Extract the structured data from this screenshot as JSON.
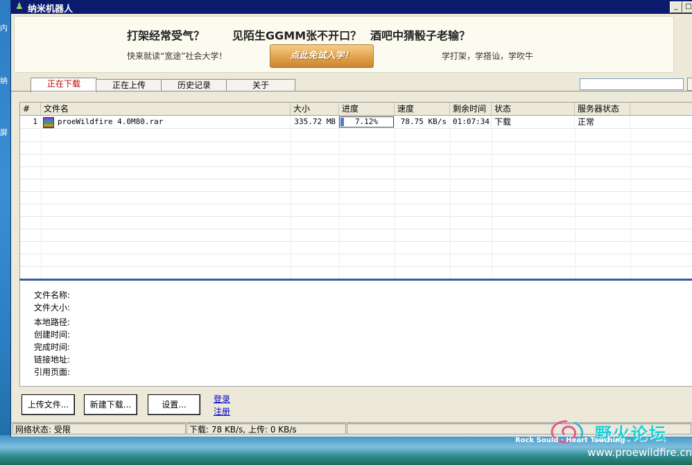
{
  "desktop": {
    "left_labels": [
      "内",
      "纳",
      "屏"
    ]
  },
  "window": {
    "title": "纳米机器人",
    "min_label": "_",
    "max_label": "□"
  },
  "banner": {
    "ad1": "打架经常受气？",
    "ad2": "见陌生GGMM张不开口？",
    "ad3": "酒吧中猜骰子老输？",
    "sub1": "快来就读“宽途”社会大学！",
    "button": "点此免试入学！",
    "sub2": "学打架，学搭讪，学吹牛"
  },
  "tabs": [
    {
      "label": "正在下载",
      "active": true
    },
    {
      "label": "正在上传",
      "active": false
    },
    {
      "label": "历史记录",
      "active": false
    },
    {
      "label": "关于",
      "active": false
    }
  ],
  "list": {
    "columns": [
      "#",
      "文件名",
      "大小",
      "进度",
      "速度",
      "剩余时间",
      "状态",
      "服务器状态"
    ],
    "rows": [
      {
        "index": "1",
        "filename": "proeWildfire 4.0M80.rar",
        "size": "335.72 MB",
        "progress_text": "7.12%",
        "progress": 0.0712,
        "speed": "78.75 KB/s",
        "remaining": "01:07:34",
        "status": "下载",
        "server_status": "正常"
      }
    ]
  },
  "details": {
    "labels": [
      "文件名称:",
      "文件大小:",
      "本地路径:",
      "创建时间:",
      "完成时间:",
      "链接地址:",
      "引用页面:"
    ]
  },
  "buttons": {
    "upload": "上传文件...",
    "new_download": "新建下载...",
    "settings": "设置..."
  },
  "links": {
    "login": "登录",
    "register": "注册"
  },
  "statusbar": {
    "network": "网络状态: 受限",
    "speed": "下载: 78 KB/s, 上传: 0 KB/s"
  },
  "watermark": {
    "text": "野火论坛",
    "url": "www.proewildfire.cn",
    "tagline": "Rock Sould · Heart Touching"
  }
}
